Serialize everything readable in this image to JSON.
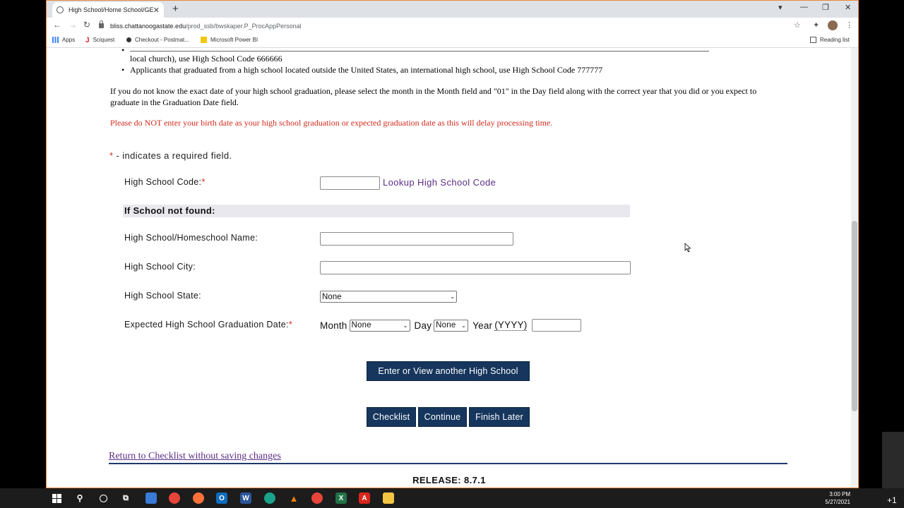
{
  "browser": {
    "tab_title": "High School/Home School/GED",
    "url_host": "bliss.chattanoogastate.edu",
    "url_path": "/prod_ssb/bwskaper.P_ProcAppPersonal",
    "bookmarks": [
      "Apps",
      "Sciquest",
      "Checkout - Postmat...",
      "Microsoft Power BI"
    ],
    "reading_list": "Reading list"
  },
  "content": {
    "bullet_partial": "local church), use High School Code 666666",
    "bullet_intl": "Applicants that graduated from a high school located outside the United States, an international high school, use High School Code 777777",
    "graduation_note": "If you do not know the exact date of your high school graduation, please select the month in the Month field and \"01\" in the Day field along with the correct year that you did or you expect to graduate in the Graduation Date field.",
    "warning": "Please do NOT enter your birth date as your high school graduation or expected graduation date as this will delay processing time.",
    "required_note": "- indicates a required field.",
    "required_star": "*"
  },
  "form": {
    "hs_code_label": "High School Code:",
    "hs_code_value": "",
    "lookup_link": "Lookup High School Code",
    "not_found_header": "If School not found:",
    "name_label": "High School/Homeschool Name:",
    "city_label": "High School City:",
    "state_label": "High School State:",
    "state_value": "None",
    "grad_date_label": "Expected High School Graduation Date:",
    "month_label": "Month",
    "month_value": "None",
    "day_label": "Day",
    "day_value": "None",
    "year_label": "Year",
    "year_format": "(YYYY)",
    "year_value": ""
  },
  "buttons": {
    "another_hs": "Enter or View another High School",
    "checklist": "Checklist",
    "continue": "Continue",
    "finish_later": "Finish Later"
  },
  "footer": {
    "return_link": "Return to Checklist without saving changes",
    "release": "RELEASE: 8.7.1"
  },
  "taskbar": {
    "time": "3:00 PM",
    "date": "5/27/2021",
    "notification_count": "+1"
  }
}
